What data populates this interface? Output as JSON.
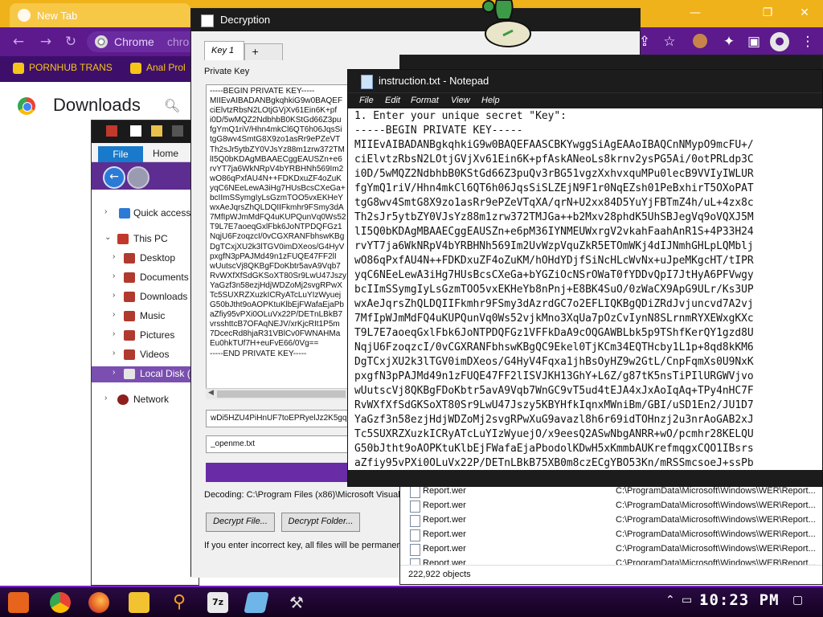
{
  "chrome": {
    "tab_title": "New Tab",
    "omnibox_label": "Chrome",
    "omnibox_text": "chro",
    "bookmarks": [
      "PORNHUB TRANS",
      "Anal Prol"
    ],
    "page_title": "Downloads",
    "colors": {
      "tabbar": "#f0b21a",
      "toolbar": "#5c1a8c",
      "bookmarks": "#3d0f6b"
    },
    "icons": [
      "back-icon",
      "forward-icon",
      "reload-icon",
      "share-icon",
      "star-icon",
      "extensions-icon",
      "profile-icon",
      "menu-icon",
      "search-icon"
    ]
  },
  "explorer": {
    "ribbon_file": "File",
    "ribbon_home": "Home",
    "tree": [
      {
        "label": "Quick access",
        "icon": "star-icon"
      },
      {
        "label": "This PC",
        "icon": "computer-icon"
      },
      {
        "label": "Desktop",
        "icon": "folder-icon"
      },
      {
        "label": "Documents",
        "icon": "folder-icon"
      },
      {
        "label": "Downloads",
        "icon": "folder-icon"
      },
      {
        "label": "Music",
        "icon": "folder-icon"
      },
      {
        "label": "Pictures",
        "icon": "folder-icon"
      },
      {
        "label": "Videos",
        "icon": "folder-icon"
      },
      {
        "label": "Local Disk (",
        "icon": "drive-icon"
      },
      {
        "label": "Network",
        "icon": "network-icon"
      }
    ]
  },
  "decryption": {
    "title": "Decryption",
    "tabs": [
      "Key 1",
      "+"
    ],
    "private_key_label": "Private Key",
    "key_text": "-----BEGIN PRIVATE KEY-----\nMIIEvAIBADANBgkqhkiG9w0BAQEF\nciElvtzRbsN2LOtjGVjXv61Ein6K+pf\ni0D/5wMQZ2NdbhbB0KStGd66Z3pu\nfgYmQ1riV/Hhn4mkCl6QT6h06JqsSi\ntgG8wv4SmtG8X9zo1asRr9ePZeVT\nTh2sJr5ytbZY0VJsYz88m1zrw372TM\nlI5Q0bKDAgMBAAECggEAUSZn+e6\nrvYT7ja6WkNRpV4bYRBHNh569Im2\nwO86qPxfAU4N++FDKDxuZF4oZuK\nyqC6NEeLewA3iHg7HUsBcsCXeGa+\nbcIImSSymgIyLsGzmTOO5vxEKHeY\nwxAeJqrsZhQLDQIIFkmhr9FSmy3dA\n7MfIpWJmMdFQ4uKUPQunVq0Ws52\nT9L7E7aoeqGxlFbk6JoNTPDQFGz1\nNqjU6FzoqzcI/0vCGXRANFbhswKBg\nDgTCxjXU2k3lTGV0imDXeos/G4HyV\npxgfN3pPAJMd49n1zFUQE47FF2lI\nwUutscVj8QKBgFDoKbtr5avA9Vqb7\nRvWXfXfSdGKSoXT80Sr9LwU47Jszy\nYaGzf3n58ezjHdjWDZoMj2svgRPwX\nTc5SUXRZXuzkICRyATcLuYIzWyuej\nG50bJtht9oAOPKtuKlbEjFWafaEjaPb\naZfiy95vPXi0OLuVx22P/DETnLBkB7\nvrsshttcB7OFAqNEJV/xrKjcRIt1P5m\n7DcecRd8hjaR31VBlCv0FWNAHMa\nEu0hkTUf7H+euFvE66/0Vg==\n-----END PRIVATE KEY-----",
    "field1_value": "wDi5HZU4PiHnUF7toEPRyelJz2K5gq",
    "field2_value": "_openme.txt",
    "progress": 1.0,
    "decoding_text": "Decoding: C:\\Program Files (x86)\\Microsoft Visual S",
    "btn_decrypt_file": "Decrypt File...",
    "btn_decrypt_folder": "Decrypt Folder...",
    "warning_text": "If you enter incorrect key, all files will be permaner",
    "accent": "#6a2ca6"
  },
  "wer": {
    "rows": [
      {
        "name": "Report.wer",
        "path": "C:\\ProgramData\\Microsoft\\Windows\\WER\\Report..."
      },
      {
        "name": "Report.wer",
        "path": "C:\\ProgramData\\Microsoft\\Windows\\WER\\Report..."
      },
      {
        "name": "Report.wer",
        "path": "C:\\ProgramData\\Microsoft\\Windows\\WER\\Report..."
      },
      {
        "name": "Report.wer",
        "path": "C:\\ProgramData\\Microsoft\\Windows\\WER\\Report..."
      },
      {
        "name": "Report.wer",
        "path": "C:\\ProgramData\\Microsoft\\Windows\\WER\\Report..."
      },
      {
        "name": "Report.wer",
        "path": "C:\\ProgramData\\Microsoft\\Windows\\WER\\Report..."
      }
    ],
    "status": "222,922 objects"
  },
  "notepad": {
    "title": "instruction.txt - Notepad",
    "menu": [
      "File",
      "Edit",
      "Format",
      "View",
      "Help"
    ],
    "content": "1. Enter your unique secret \"Key\":\n-----BEGIN PRIVATE KEY-----\nMIIEvAIBADANBgkqhkiG9w0BAQEFAASCBKYwggSiAgEAAoIBAQCnNMypO9mcFU+/\nciElvtzRbsN2LOtjGVjXv61Ein6K+pfAskANeoLs8krnv2ysPG5Ai/0otPRLdp3C\ni0D/5wMQZ2NdbhbB0KStGd66Z3puQv3rBG51vgzXxhvxquMPu0lecB9VVIyIWLUR\nfgYmQ1riV/Hhn4mkCl6QT6h06JqsSiSLZEjN9F1r0NqEZsh01PeBxhirT5OXoPAT\ntgG8wv4SmtG8X9zo1asRr9ePZeVTqXA/qrN+U2xx84D5YuYjFBTmZ4h/uL+4zx8c\nTh2sJr5ytbZY0VJsYz88m1zrw372TMJGa++b2Mxv28phdK5UhSBJegVq9oVQXJ5M\nlI5Q0bKDAgMBAAECggEAUSZn+e6pM36IYNMEUWxrgV2vkahFaahAnR1S+4P33H24\nrvYT7ja6WkNRpV4bYRBHNh569Im2UvWzpVquZkR5ETOmWKj4dIJNmhGHLpLQMblj\nwO86qPxfAU4N++FDKDxuZF4oZuKM/hOHdYDjfSiNcHLcWvNx+uJpeMKgcHT/tIPR\nyqC6NEeLewA3iHg7HUsBcsCXeGa+bYGZiOcNSrOWaT0fYDDvQpI7JtHyA6PFVwgy\nbcIImSSymgIyLsGzmTOO5vxEKHeYb8nPnj+E8BK4SuO/0zWaCX9ApG9ULr/Ks3UP\nwxAeJqrsZhQLDQIIFkmhr9FSmy3dAzrdGC7o2EFLIQKBgQDiZRdJvjuncvd7A2vj\n7MfIpWJmMdFQ4uKUPQunVq0Ws52vjkMno3XqUa7pOzCvIynN8SLrnmRYXEWxgKXc\nT9L7E7aoeqGxlFbk6JoNTPDQFGz1VFFkDaA9cOQGAWBLbk5p9TShfKerQY1gzd8U\nNqjU6FzoqzcI/0vCGXRANFbhswKBgQC9Ekel0TjKCm34EQTHcby1L1p+8qd8kKM6\nDgTCxjXU2k3lTGV0imDXeos/G4HyV4Fqxa1jhBsOyHZ9w2GtL/CnpFqmXs0U9NxK\npxgfN3pPAJMd49n1zFUQE47FF2lISVJKH13GhY+L6Z/g87tK5nsTiPIlURGWVjvo\nwUutscVj8QKBgFDoKbtr5avA9Vqb7WnGC9vT5ud4tEJA4xJxAoIqAq+TPy4nHC7F\nRvWXfXfSdGKSoXT80Sr9LwU47Jszy5KBYHfkIqnxMWniBm/GBI/uSD1En2/JU1D7\nYaGzf3n58ezjHdjWDZoMj2svgRPwXuG9avazl8h6r69idTOHnzj2u3nrAoGAB2xJ\nTc5SUXRZXuzkICRyATcLuYIzWyuejO/x9eesQ2ASwNbgANRR+wO/pcmhr28KELQU\nG50bJtht9oAOPKtuKlbEjFWafaEjaPbodolKDwH5xKmmbAUKrefmqgxCQO1IBsrs\naZfiy95vPXi0OLuVx22P/DETnLBkB75XB0m8czECgYBO53Kn/mRSSmcsoeJ+ssPb"
  },
  "taskbar": {
    "clock": "10:23 PM",
    "pinned_icons": [
      "start-icon",
      "chrome-icon",
      "firefox-icon",
      "file-explorer-icon",
      "search-icon",
      "7zip-icon",
      "app-icon",
      "tools-icon"
    ],
    "tray_icons": [
      "network-icon",
      "volume-icon",
      "notification-icon"
    ]
  }
}
